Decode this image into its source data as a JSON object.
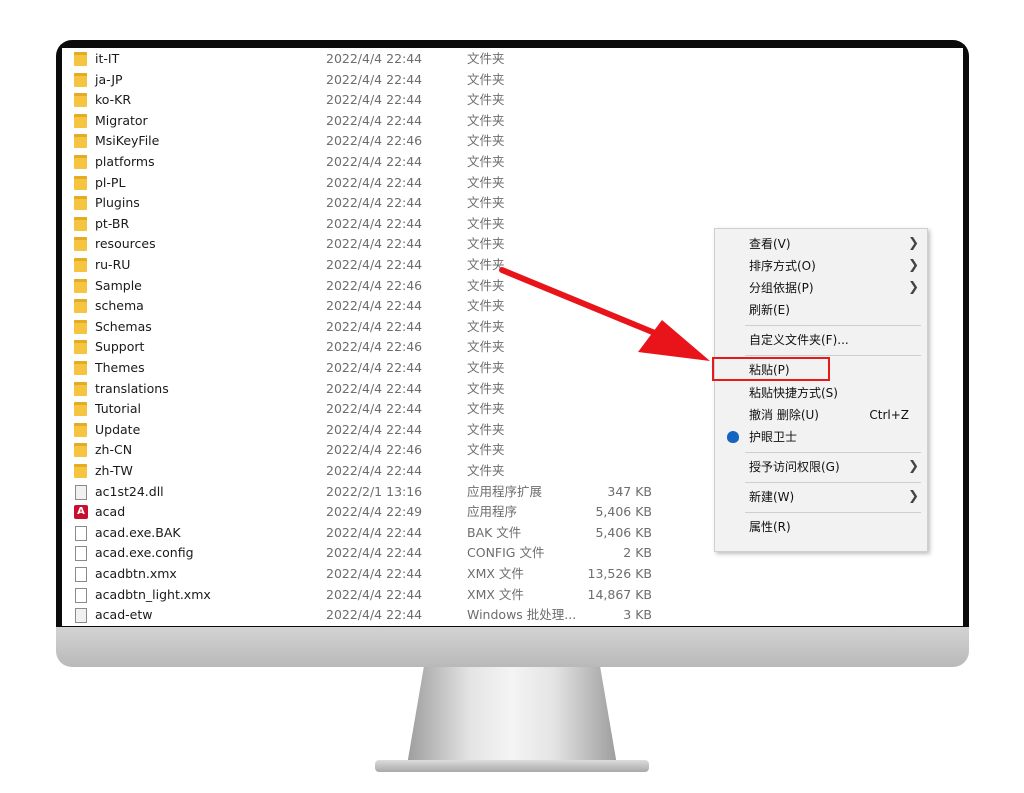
{
  "files": [
    {
      "name": "it-IT",
      "date": "2022/4/4 22:44",
      "type": "文件夹",
      "size": "",
      "icon": "folder-icon"
    },
    {
      "name": "ja-JP",
      "date": "2022/4/4 22:44",
      "type": "文件夹",
      "size": "",
      "icon": "folder-icon"
    },
    {
      "name": "ko-KR",
      "date": "2022/4/4 22:44",
      "type": "文件夹",
      "size": "",
      "icon": "folder-icon"
    },
    {
      "name": "Migrator",
      "date": "2022/4/4 22:44",
      "type": "文件夹",
      "size": "",
      "icon": "folder-icon"
    },
    {
      "name": "MsiKeyFile",
      "date": "2022/4/4 22:46",
      "type": "文件夹",
      "size": "",
      "icon": "folder-icon"
    },
    {
      "name": "platforms",
      "date": "2022/4/4 22:44",
      "type": "文件夹",
      "size": "",
      "icon": "folder-icon"
    },
    {
      "name": "pl-PL",
      "date": "2022/4/4 22:44",
      "type": "文件夹",
      "size": "",
      "icon": "folder-icon"
    },
    {
      "name": "Plugins",
      "date": "2022/4/4 22:44",
      "type": "文件夹",
      "size": "",
      "icon": "folder-icon"
    },
    {
      "name": "pt-BR",
      "date": "2022/4/4 22:44",
      "type": "文件夹",
      "size": "",
      "icon": "folder-icon"
    },
    {
      "name": "resources",
      "date": "2022/4/4 22:44",
      "type": "文件夹",
      "size": "",
      "icon": "folder-icon"
    },
    {
      "name": "ru-RU",
      "date": "2022/4/4 22:44",
      "type": "文件夹",
      "size": "",
      "icon": "folder-icon"
    },
    {
      "name": "Sample",
      "date": "2022/4/4 22:46",
      "type": "文件夹",
      "size": "",
      "icon": "folder-icon"
    },
    {
      "name": "schema",
      "date": "2022/4/4 22:44",
      "type": "文件夹",
      "size": "",
      "icon": "folder-icon"
    },
    {
      "name": "Schemas",
      "date": "2022/4/4 22:44",
      "type": "文件夹",
      "size": "",
      "icon": "folder-icon"
    },
    {
      "name": "Support",
      "date": "2022/4/4 22:46",
      "type": "文件夹",
      "size": "",
      "icon": "folder-icon"
    },
    {
      "name": "Themes",
      "date": "2022/4/4 22:44",
      "type": "文件夹",
      "size": "",
      "icon": "folder-icon"
    },
    {
      "name": "translations",
      "date": "2022/4/4 22:44",
      "type": "文件夹",
      "size": "",
      "icon": "folder-icon"
    },
    {
      "name": "Tutorial",
      "date": "2022/4/4 22:44",
      "type": "文件夹",
      "size": "",
      "icon": "folder-icon"
    },
    {
      "name": "Update",
      "date": "2022/4/4 22:44",
      "type": "文件夹",
      "size": "",
      "icon": "folder-icon"
    },
    {
      "name": "zh-CN",
      "date": "2022/4/4 22:46",
      "type": "文件夹",
      "size": "",
      "icon": "folder-icon"
    },
    {
      "name": "zh-TW",
      "date": "2022/4/4 22:44",
      "type": "文件夹",
      "size": "",
      "icon": "folder-icon"
    },
    {
      "name": "ac1st24.dll",
      "date": "2022/2/1 13:16",
      "type": "应用程序扩展",
      "size": "347 KB",
      "icon": "dll-file-icon"
    },
    {
      "name": "acad",
      "date": "2022/4/4 22:49",
      "type": "应用程序",
      "size": "5,406 KB",
      "icon": "autocad-app-icon"
    },
    {
      "name": "acad.exe.BAK",
      "date": "2022/4/4 22:44",
      "type": "BAK 文件",
      "size": "5,406 KB",
      "icon": "file-icon"
    },
    {
      "name": "acad.exe.config",
      "date": "2022/4/4 22:44",
      "type": "CONFIG 文件",
      "size": "2 KB",
      "icon": "file-icon"
    },
    {
      "name": "acadbtn.xmx",
      "date": "2022/4/4 22:44",
      "type": "XMX 文件",
      "size": "13,526 KB",
      "icon": "file-icon"
    },
    {
      "name": "acadbtn_light.xmx",
      "date": "2022/4/4 22:44",
      "type": "XMX 文件",
      "size": "14,867 KB",
      "icon": "file-icon"
    },
    {
      "name": "acad-etw",
      "date": "2022/4/4 22:44",
      "type": "Windows 批处理...",
      "size": "3 KB",
      "icon": "batch-file-icon"
    }
  ],
  "context_menu": {
    "view": "查看(V)",
    "sort": "排序方式(O)",
    "group": "分组依据(P)",
    "refresh": "刷新(E)",
    "customize": "自定义文件夹(F)...",
    "paste": "粘贴(P)",
    "paste_shortcut": "粘贴快捷方式(S)",
    "undo_delete": "撤消 删除(U)",
    "undo_shortcut": "Ctrl+Z",
    "eye_guard": "护眼卫士",
    "grant_access": "授予访问权限(G)",
    "new": "新建(W)",
    "properties": "属性(R)"
  },
  "colors": {
    "highlight": "#e31b1b",
    "folder": "#f5c542",
    "arrow": "#e8141a"
  }
}
